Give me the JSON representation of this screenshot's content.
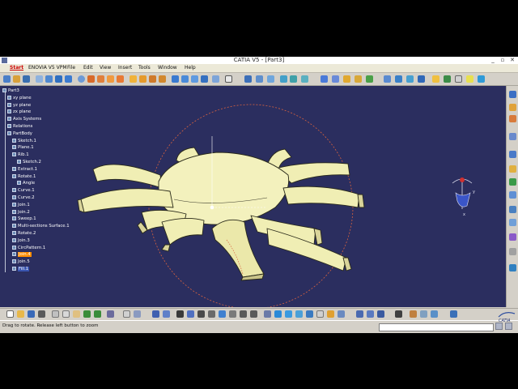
{
  "window": {
    "title": "CATIA V5 - [Part3]",
    "minimize_label": "_",
    "restore_label": "▫",
    "close_label": "✕"
  },
  "menu": [
    "Start",
    "ENOVIA V5 VPM",
    "File",
    "Edit",
    "View",
    "Insert",
    "Tools",
    "Window",
    "Help"
  ],
  "tree": [
    {
      "label": "Part3",
      "depth": 0,
      "icon": "part-icon",
      "state": ""
    },
    {
      "label": "xy plane",
      "depth": 1,
      "icon": "plane-icon",
      "state": ""
    },
    {
      "label": "yz plane",
      "depth": 1,
      "icon": "plane-icon",
      "state": ""
    },
    {
      "label": "zx plane",
      "depth": 1,
      "icon": "plane-icon",
      "state": ""
    },
    {
      "label": "Axis Systems",
      "depth": 1,
      "icon": "axis-icon",
      "state": ""
    },
    {
      "label": "Relations",
      "depth": 1,
      "icon": "relations-icon",
      "state": ""
    },
    {
      "label": "PartBody",
      "depth": 1,
      "icon": "body-icon",
      "state": ""
    },
    {
      "label": "Sketch.1",
      "depth": 2,
      "icon": "sketch-icon",
      "state": ""
    },
    {
      "label": "Plane.1",
      "depth": 2,
      "icon": "plane-icon",
      "state": ""
    },
    {
      "label": "Rib.1",
      "depth": 2,
      "icon": "rib-icon",
      "state": ""
    },
    {
      "label": "Sketch.2",
      "depth": 3,
      "icon": "sketch-icon",
      "state": ""
    },
    {
      "label": "Extract.1",
      "depth": 2,
      "icon": "extract-icon",
      "state": ""
    },
    {
      "label": "Rotate.1",
      "depth": 2,
      "icon": "rotate-icon",
      "state": ""
    },
    {
      "label": "Angle",
      "depth": 3,
      "icon": "angle-icon",
      "state": ""
    },
    {
      "label": "Curve.1",
      "depth": 2,
      "icon": "curve-icon",
      "state": ""
    },
    {
      "label": "Curve.2",
      "depth": 2,
      "icon": "curve-icon",
      "state": ""
    },
    {
      "label": "Join.1",
      "depth": 2,
      "icon": "join-icon",
      "state": ""
    },
    {
      "label": "Join.2",
      "depth": 2,
      "icon": "join-icon",
      "state": ""
    },
    {
      "label": "Sweep.1",
      "depth": 2,
      "icon": "sweep-icon",
      "state": ""
    },
    {
      "label": "Multi-sections Surface.1",
      "depth": 2,
      "icon": "surface-icon",
      "state": ""
    },
    {
      "label": "Rotate.2",
      "depth": 2,
      "icon": "rotate-icon",
      "state": ""
    },
    {
      "label": "Join.3",
      "depth": 2,
      "icon": "join-icon",
      "state": ""
    },
    {
      "label": "CircPattern.1",
      "depth": 2,
      "icon": "pattern-icon",
      "state": ""
    },
    {
      "label": "Join.4",
      "depth": 2,
      "icon": "join-icon",
      "state": "highlighted"
    },
    {
      "label": "Join.5",
      "depth": 2,
      "icon": "join-icon",
      "state": ""
    },
    {
      "label": "Fill.1",
      "depth": 2,
      "icon": "fill-icon",
      "state": "selected"
    }
  ],
  "status": {
    "message": "Drag to rotate. Release left button to zoom"
  },
  "compass": {
    "x_label": "x",
    "y_label": "y",
    "z_label": "z"
  },
  "branding": {
    "logo_text": "CATIA"
  },
  "colors": {
    "viewport_bg": "#2b2e5f",
    "model_fill": "#f0eeb4",
    "model_shade": "#c9c48a",
    "model_edge": "#2a2a1a",
    "orbit_circle": "#d8623f",
    "highlight": "#ff8c00"
  }
}
